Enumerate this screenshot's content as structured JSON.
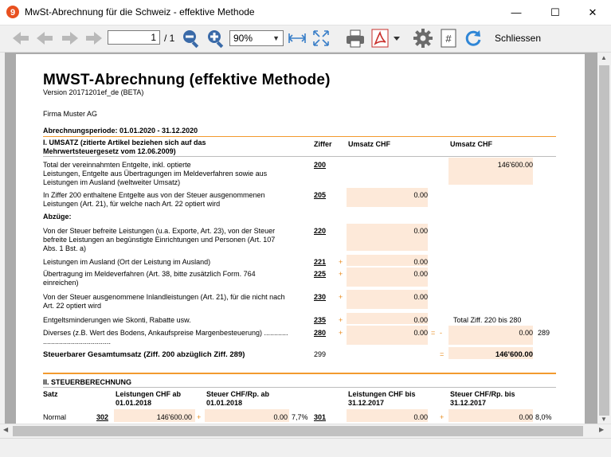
{
  "window": {
    "title": "MwSt-Abrechnung für die Schweiz - effektive Methode",
    "minimize": "—",
    "maximize": "☐",
    "close": "✕"
  },
  "toolbar": {
    "page_current": "1",
    "page_total": "/ 1",
    "zoom": "90%",
    "close_label": "Schliessen"
  },
  "doc": {
    "title": "MWST-Abrechnung (effektive Methode)",
    "version": "Version 20171201ef_de (BETA)",
    "company": "Firma Muster AG",
    "period": "Abrechnungsperiode: 01.01.2020 - 31.12.2020",
    "sec1_title": "I. UMSATZ (zitierte Artikel beziehen sich auf das",
    "sec1_title2": "Mehrwertsteuergesetz vom 12.06.2009)",
    "col_ziffer": "Ziffer",
    "col_umsatz1": "Umsatz CHF",
    "col_umsatz2": "Umsatz CHF",
    "r200_l1": "Total der vereinnahmten Entgelte, inkl. optierte",
    "r200_l2": "Leistungen, Entgelte aus Übertragungen im Meldeverfahren sowie aus",
    "r200_l3": "Leistungen im Ausland (weltweiter Umsatz)",
    "r200_code": "200",
    "r200_val": "146'600.00",
    "r205_l1": "In Ziffer 200 enthaltene Entgelte aus von der Steuer ausgenommenen",
    "r205_l2": "Leistungen (Art. 21), für welche nach Art. 22 optiert wird",
    "r205_code": "205",
    "r205_val": "0.00",
    "abzuege": "Abzüge:",
    "r220_l1": "Von der Steuer befreite Leistungen (u.a. Exporte, Art. 23), von der Steuer",
    "r220_l2": "befreite Leistungen an begünstigte Einrichtungen und Personen (Art. 107",
    "r220_l3": "Abs. 1 Bst. a)",
    "r220_code": "220",
    "r220_val": "0.00",
    "r221_l1": "Leistungen im Ausland (Ort der Leistung im Ausland)",
    "r221_code": "221",
    "r221_val": "0.00",
    "r225_l1": "Übertragung im Meldeverfahren (Art. 38, bitte zusätzlich Form. 764",
    "r225_l2": "einreichen)",
    "r225_code": "225",
    "r225_val": "0.00",
    "r230_l1": "Von der Steuer ausgenommene Inlandleistungen (Art. 21), für die nicht nach",
    "r230_l2": "Art. 22 optiert wird",
    "r230_code": "230",
    "r230_val": "0.00",
    "r235_l1": "Entgeltsminderungen wie Skonti, Rabatte usw.",
    "r235_code": "235",
    "r235_val": "0.00",
    "r235_note": "Total Ziff. 220 bis 280",
    "r280_l1": "Diverses (z.B. Wert des Bodens, Ankaufspreise Margenbesteuerung) ............",
    "r280_l2": "..................................",
    "r280_code": "280",
    "r280_val": "0.00",
    "r289_val": "0.00",
    "r289_code": "289",
    "r299_label": "Steuerbarer Gesamtumsatz (Ziff. 200 abzüglich Ziff. 289)",
    "r299_code": "299",
    "r299_val": "146'600.00",
    "plus": "+",
    "equals": "=",
    "minus": "-",
    "sec2_title": "II. STEUERBERECHNUNG",
    "s2_satz": "Satz",
    "s2_h1a": "Leistungen CHF ab",
    "s2_h1b": "01.01.2018",
    "s2_h2a": "Steuer CHF/Rp. ab",
    "s2_h2b": "01.01.2018",
    "s2_h3a": "Leistungen CHF bis",
    "s2_h3b": "31.12.2017",
    "s2_h4a": "Steuer CHF/Rp. bis",
    "s2_h4b": "31.12.2017",
    "s2_normal": "Normal",
    "s2_c302": "302",
    "s2_v302": "146'600.00",
    "s2_tax302": "0.00",
    "s2_rate302": "7,7%",
    "s2_c301": "301",
    "s2_v301": "0.00",
    "s2_tax301": "0.00",
    "s2_rate301": "8,0%"
  },
  "colors": {
    "accent_orange": "#f29a2e",
    "peach_fill": "#fde9d9"
  }
}
